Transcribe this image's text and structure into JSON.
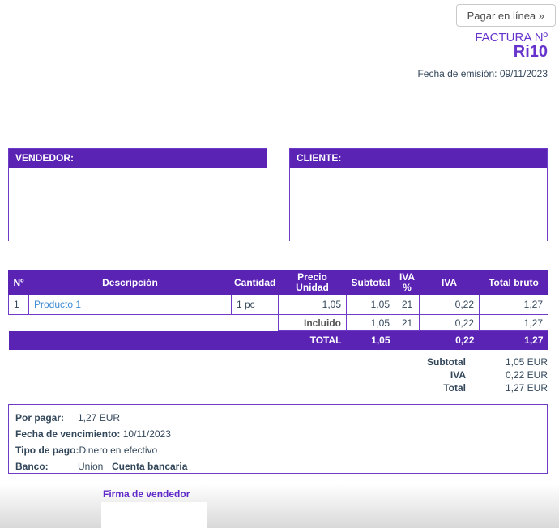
{
  "header": {
    "pay_button_label": "Pagar en línea »",
    "invoice_label": "FACTURA Nº",
    "invoice_number": "Ri10",
    "issue_date": "Fecha de emisión: 09/11/2023"
  },
  "colors": {
    "purple_fill": "#5a23b4",
    "purple_border": "#6d3bc6",
    "purple_text": "#6633cc",
    "navy_text": "#33475b",
    "link_blue": "#3d8bd4"
  },
  "seller_box": {
    "title": "VENDEDOR:"
  },
  "client_box": {
    "title": "CLIENTE:"
  },
  "invoice_table": {
    "headers": [
      "Nº",
      "Descripción",
      "Cantidad",
      "Precio Unidad",
      "Subtotal",
      "IVA %",
      "IVA",
      "Total bruto"
    ],
    "row": {
      "num": "1",
      "description": "Producto 1",
      "quantity": "1 pc",
      "unit_price": "1,05",
      "subtotal": "1,05",
      "vat_pct": "21",
      "vat": "0,22",
      "gross": "1,27"
    },
    "included_row": {
      "label": "Incluido",
      "subtotal": "1,05",
      "vat_pct": "21",
      "vat": "0,22",
      "gross": "1,27"
    },
    "total_row": {
      "label": "TOTAL",
      "subtotal": "1,05",
      "vat": "0,22",
      "gross": "1,27"
    }
  },
  "summary": {
    "rows": [
      {
        "label": "Subtotal",
        "value": "1,05 EUR"
      },
      {
        "label": "IVA",
        "value": "0,22 EUR"
      },
      {
        "label": "Total",
        "value": "1,27 EUR"
      }
    ]
  },
  "payment": {
    "due_label": "Por pagar:",
    "due_value": "1,27 EUR",
    "deadline_label": "Fecha de vencimiento:",
    "deadline_value": "10/11/2023",
    "type_label": "Tipo de pago:",
    "type_value": "Dinero en efectivo",
    "bank_label": "Banco:",
    "bank_value": "Union",
    "bank_account_label": "Cuenta bancaria"
  },
  "signature": {
    "label": "Firma de vendedor"
  }
}
